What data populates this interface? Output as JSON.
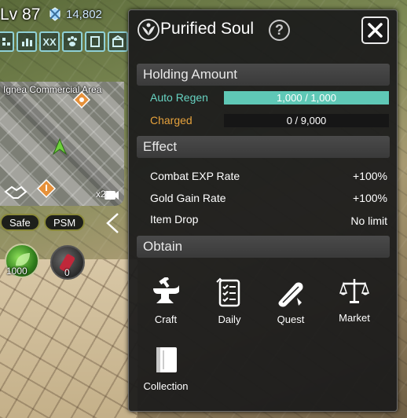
{
  "hud": {
    "level": "Lv 87",
    "currency": "14,802",
    "quickbar_xx": "XX"
  },
  "minimap": {
    "area_name": "Ignea Commercial Area",
    "multiplier": "x2"
  },
  "status": {
    "safe": "Safe",
    "psm": "PSM"
  },
  "potions": {
    "green_count": "1000",
    "red_count": "0"
  },
  "dialog": {
    "title": "Purified Soul",
    "help": "?",
    "holding": {
      "header": "Holding Amount",
      "auto_regen_label": "Auto Regen",
      "auto_regen_value": "1,000 / 1,000",
      "auto_regen_fraction": 1.0,
      "charged_label": "Charged",
      "charged_value": "0 / 9,000",
      "charged_fraction": 0.0
    },
    "effect": {
      "header": "Effect",
      "rows": [
        {
          "label": "Combat EXP Rate",
          "value": "+100%"
        },
        {
          "label": "Gold Gain Rate",
          "value": "+100%"
        },
        {
          "label": "Item Drop",
          "value": "No limit"
        }
      ]
    },
    "obtain": {
      "header": "Obtain",
      "items": [
        {
          "label": "Craft",
          "icon": "anvil-icon"
        },
        {
          "label": "Daily",
          "icon": "checklist-icon"
        },
        {
          "label": "Quest",
          "icon": "scroll-icon"
        },
        {
          "label": "Market",
          "icon": "scales-icon"
        },
        {
          "label": "Collection",
          "icon": "book-icon"
        }
      ]
    }
  },
  "colors": {
    "accent_teal": "#5fc8b6",
    "auto_regen_label": "#67d3c2",
    "charged_label": "#e6a23c"
  }
}
